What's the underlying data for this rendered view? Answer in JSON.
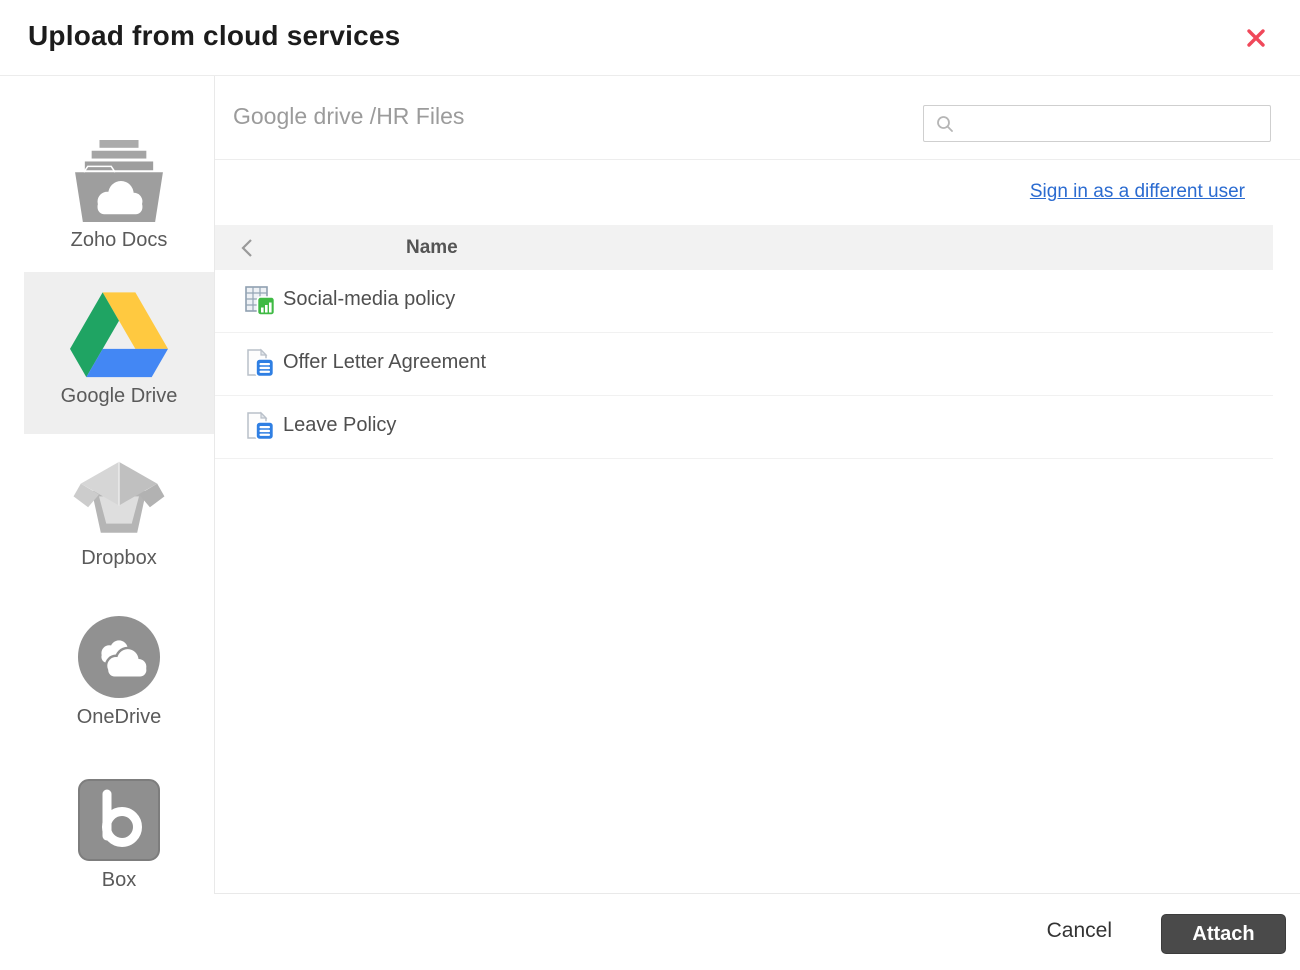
{
  "dialog": {
    "title": "Upload from cloud services",
    "close_icon": "x-icon"
  },
  "sidebar": {
    "items": [
      {
        "id": "zoho-docs",
        "label": "Zoho Docs",
        "icon": "zoho-docs-folder-icon",
        "selected": false
      },
      {
        "id": "google-drive",
        "label": "Google Drive",
        "icon": "google-drive-icon",
        "selected": true
      },
      {
        "id": "dropbox",
        "label": "Dropbox",
        "icon": "dropbox-box-icon",
        "selected": false
      },
      {
        "id": "onedrive",
        "label": "OneDrive",
        "icon": "onedrive-cloud-icon",
        "selected": false
      },
      {
        "id": "box",
        "label": "Box",
        "icon": "box-b-icon",
        "selected": false
      }
    ]
  },
  "content": {
    "breadcrumb": "Google drive /HR Files",
    "search": {
      "value": "",
      "icon": "search-icon"
    },
    "sign_in_link": "Sign in as a different user",
    "table": {
      "back_icon": "chevron-left-icon",
      "columns": [
        "Name"
      ],
      "rows": [
        {
          "name": "Social-media policy",
          "icon": "spreadsheet-file-icon"
        },
        {
          "name": "Offer Letter Agreement",
          "icon": "document-file-icon"
        },
        {
          "name": "Leave Policy",
          "icon": "document-file-icon"
        }
      ]
    }
  },
  "footer": {
    "cancel_label": "Cancel",
    "attach_label": "Attach"
  },
  "colors": {
    "close_icon": "#f0485a",
    "link_blue": "#2b6bd0",
    "attach_button_bg": "#4a4a4a",
    "selected_item_bg": "#efefef",
    "table_header_bg": "#f2f2f2",
    "drive_green": "#1fa463",
    "drive_yellow": "#ffc940",
    "drive_blue": "#4387f4",
    "spreadsheet_green": "#3fba44",
    "document_blue": "#2f7fe3",
    "gray_icon": "#9e9e9e"
  }
}
